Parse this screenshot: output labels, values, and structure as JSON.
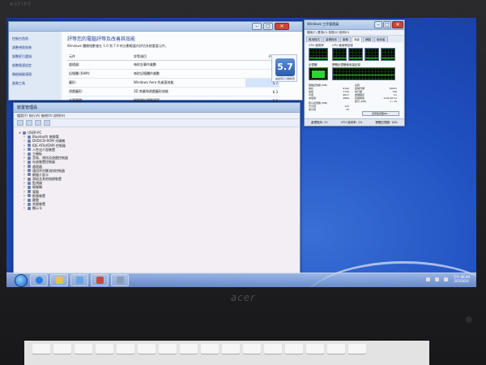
{
  "bezel": {
    "brand_top": "ASPIRE",
    "brand_bottom": "acer"
  },
  "performance": {
    "title": "效能資訊及工具",
    "sidebar": [
      "控制台首頁",
      "調整視覺效果",
      "調整索引選項",
      "調整電源設定",
      "開啟磁碟清理",
      "進階工具"
    ],
    "heading": "評等您的電腦評等及改善其效能",
    "subtitle": "Windows 體驗指數會在 1.0 到 7.9 的分數範圍內評估系統重要元件。",
    "columns": {
      "component": "元件",
      "rating": "評等項目",
      "subscore": "子分數",
      "basescore": "基本分數"
    },
    "rows": [
      {
        "component": "處理器:",
        "desc": "每秒計算作業數",
        "score": "7.4"
      },
      {
        "component": "記憶體 (RAM):",
        "desc": "每秒記憶體作業數",
        "score": "7.7"
      },
      {
        "component": "圖形:",
        "desc": "Windows Aero 的桌面效能",
        "score": "5.7"
      },
      {
        "component": "遊戲圖形:",
        "desc": "3D 商業和遊戲圖形效能",
        "score": "6.3"
      },
      {
        "component": "主要硬碟:",
        "desc": "磁碟資料傳輸速率",
        "score": "5.9"
      }
    ],
    "base_score": "5.7",
    "base_caption": "由最低子分數判定"
  },
  "device_manager": {
    "title": "裝置管理員",
    "menu": "檔案(F)  執行(A)  檢視(V)  說明(H)",
    "root": "USER-PC",
    "items": [
      "Bluetooth 無線電",
      "DVD/CD-ROM 光碟機",
      "IDE ATA/ATAPI 控制器",
      "人性化介面裝置",
      "主機板",
      "音效、視訊及遊戲控制器",
      "存放裝置控制器",
      "處理器",
      "通用序列匯流排控制器",
      "網路介面卡",
      "滑鼠及其他指標裝置",
      "監視器",
      "磁碟機",
      "電腦",
      "影像裝置",
      "鍵盤",
      "系統裝置",
      "顯示卡"
    ]
  },
  "task_manager": {
    "title": "Windows 工作管理員",
    "menu": "檔案(F)  選項(O)  檢視(V)  說明(H)",
    "tabs": [
      "應用程式",
      "處理程序",
      "服務",
      "效能",
      "網路",
      "使用者"
    ],
    "active_tab": "效能",
    "cpu_usage_label": "CPU 使用率",
    "cpu_history_label": "CPU 使用率記錄",
    "cpu_value": "1 %",
    "memory_label": "記憶體",
    "memory_history_label": "實體記憶體使用量記錄",
    "memory_value": "1.41 GB",
    "physical_memory": {
      "heading": "實體記憶體 (MB)",
      "rows": [
        [
          "總計",
          "8100"
        ],
        [
          "快取",
          "1739"
        ],
        [
          "可用",
          "6617"
        ],
        [
          "未使用",
          "4889"
        ]
      ]
    },
    "system": {
      "heading": "系統",
      "rows": [
        [
          "控制代碼",
          "15641"
        ],
        [
          "執行緒",
          "706"
        ],
        [
          "處理程序",
          "51"
        ],
        [
          "存留時間",
          "0:00:08:31"
        ],
        [
          "認可 (MB)",
          "1 / 15"
        ]
      ]
    },
    "kernel": {
      "heading": "核心記憶體 (MB)",
      "rows": [
        [
          "已分頁",
          "115"
        ],
        [
          "未分頁",
          "35"
        ]
      ]
    },
    "resource_button": "資源監視器(R)...",
    "status": {
      "processes": "處理程序: 51",
      "cpu": "CPU 使用率: 1%",
      "memory": "實體記憶體: 18%"
    }
  },
  "taskbar": {
    "clock_time": "下午 06:49",
    "clock_date": "2016/6/4"
  },
  "colors": {
    "desktop": "#1f4fc0",
    "titlebar": "#a9c3e6",
    "graph_line": "#3bd43b"
  }
}
